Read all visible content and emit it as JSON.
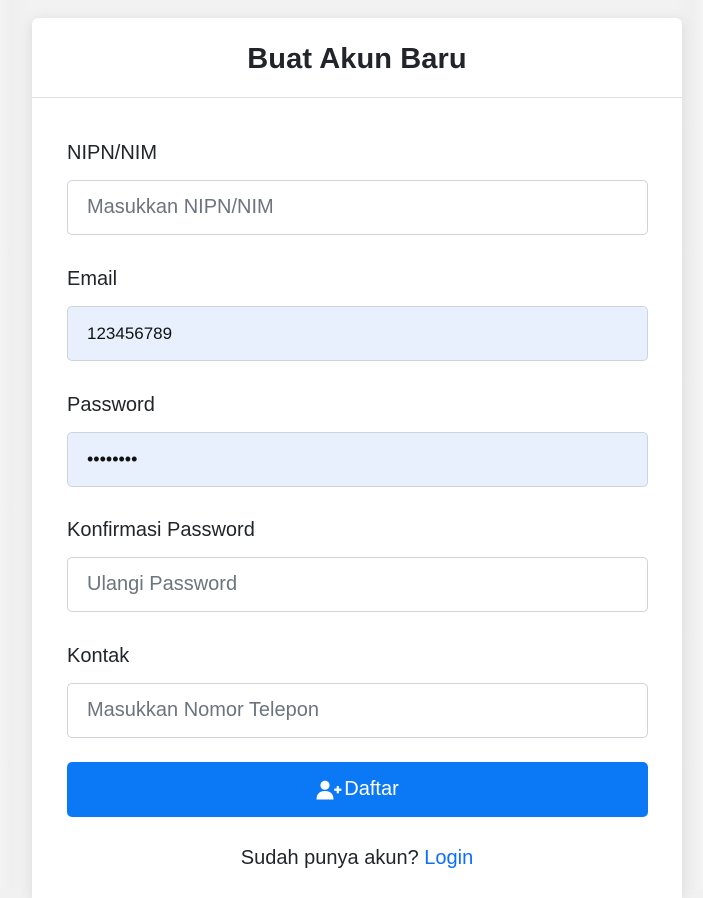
{
  "form": {
    "title": "Buat Akun Baru",
    "fields": [
      {
        "label": "NIPN/NIM",
        "value": "",
        "placeholder": "Masukkan NIPN/NIM",
        "type": "text",
        "autofilled": false
      },
      {
        "label": "Email",
        "value": "123456789",
        "placeholder": "",
        "type": "text",
        "autofilled": true
      },
      {
        "label": "Password",
        "value": "••••••••",
        "placeholder": "",
        "type": "password",
        "autofilled": true
      },
      {
        "label": "Konfirmasi Password",
        "value": "",
        "placeholder": "Ulangi Password",
        "type": "password",
        "autofilled": false
      },
      {
        "label": "Kontak",
        "value": "",
        "placeholder": "Masukkan Nomor Telepon",
        "type": "text",
        "autofilled": false
      }
    ],
    "submit_label": "Daftar",
    "submit_icon": "user-plus-icon",
    "login_prompt": "Sudah punya akun?",
    "login_link": "Login"
  },
  "colors": {
    "primary": "#0b78f6",
    "link": "#0d6efd",
    "autofill_bg": "#e8f0fe",
    "text": "#212529",
    "placeholder": "#6c757d",
    "border": "#ced4da"
  }
}
